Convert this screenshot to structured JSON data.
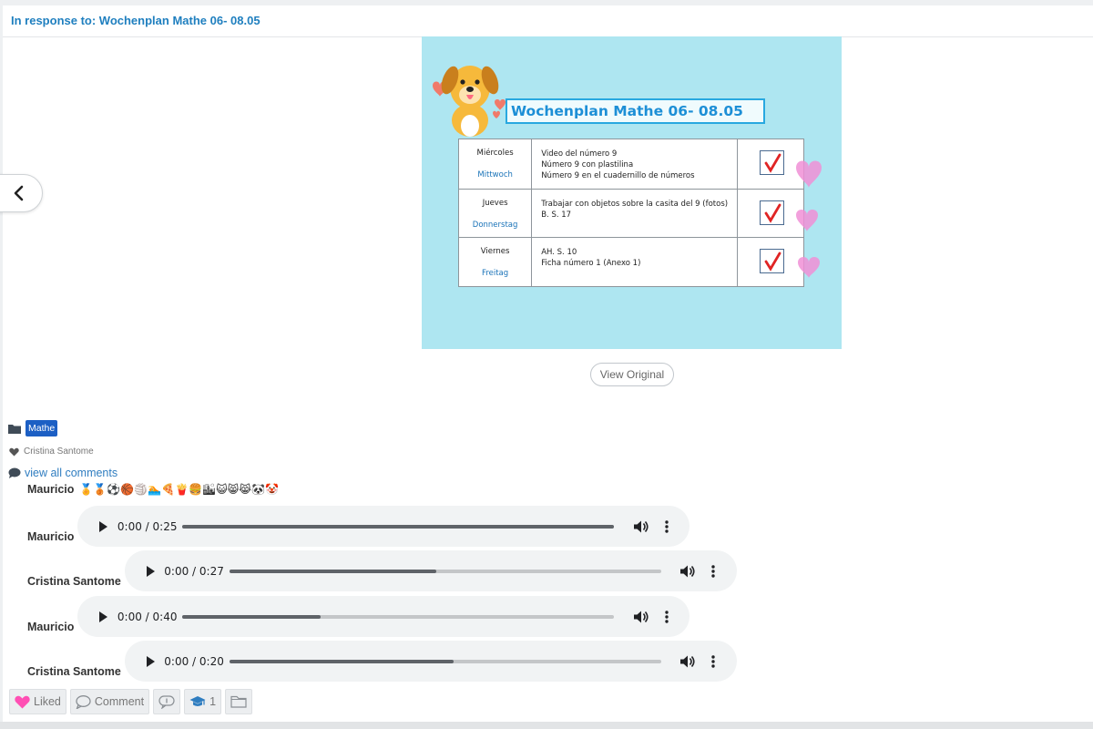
{
  "header": {
    "title": "In response to: Wochenplan Mathe 06- 08.05"
  },
  "post_image": {
    "title": "Wochenplan Mathe 06- 08.05",
    "rows": [
      {
        "day_es": "Miércoles",
        "day_de": "Mittwoch",
        "tasks": [
          "Video del número 9",
          "Número 9 con plastilina",
          "Número 9 en el cuadernillo de números"
        ]
      },
      {
        "day_es": "Jueves",
        "day_de": "Donnerstag",
        "tasks": [
          "Trabajar con objetos sobre la casita del 9 (fotos)",
          "B. S. 17"
        ]
      },
      {
        "day_es": "Viernes",
        "day_de": "Freitag",
        "tasks": [
          "AH. S. 10",
          "Ficha número 1 (Anexo 1)"
        ]
      }
    ]
  },
  "view_original_label": "View Original",
  "folder_tag": "Mathe",
  "liked_by": "Cristina Santome",
  "view_comments_label": "view all comments",
  "emoji_comment": {
    "author": "Mauricio",
    "emojis": "🏅🥉⚽🏀🏐🏊🍕🍟🍔🏙😺😸😹🐼🤡"
  },
  "audio_comments": [
    {
      "author": "Mauricio",
      "time": "0:00 / 0:25",
      "progress": 1.0
    },
    {
      "author": "Cristina Santome",
      "time": "0:00 / 0:27",
      "progress": 0.48
    },
    {
      "author": "Mauricio",
      "time": "0:00 / 0:40",
      "progress": 0.32
    },
    {
      "author": "Cristina Santome",
      "time": "0:00 / 0:20",
      "progress": 0.52
    }
  ],
  "actions": {
    "liked_label": "Liked",
    "comment_label": "Comment",
    "badge_count": "1"
  },
  "colors": {
    "accent": "#1f7fbf",
    "tag": "#1c5fc4",
    "heart": "#ff4fb4",
    "image_bg": "#aee6f1"
  }
}
